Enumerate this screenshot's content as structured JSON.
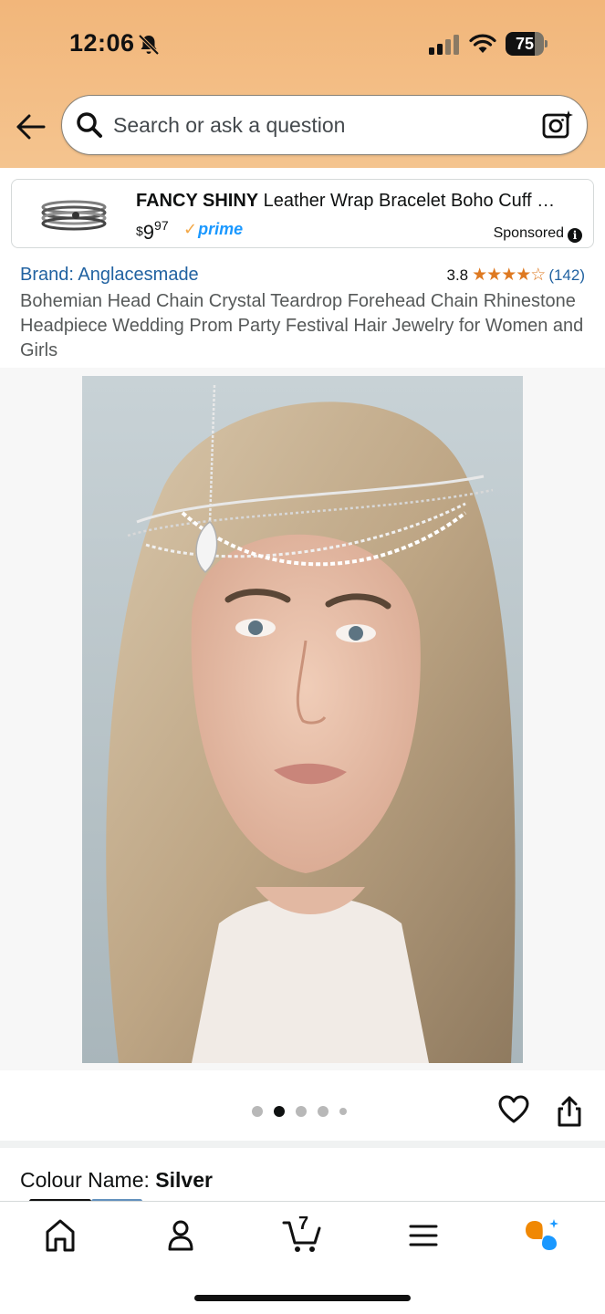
{
  "status_bar": {
    "time": "12:06",
    "battery": "75",
    "battery_level": 0.75
  },
  "header": {
    "search_placeholder": "Search or ask a question"
  },
  "sponsored": {
    "title_bold": "FANCY SHINY",
    "title_rest": " Leather Wrap Bracelet Boho Cuff …",
    "price_currency": "$",
    "price_dollars": "9",
    "price_cents": "97",
    "prime_label": "prime",
    "sponsored_label": "Sponsored",
    "info_glyph": "i"
  },
  "product": {
    "brand": "Brand: Anglacesmade",
    "rating_value": "3.8",
    "rating_stars": 3.8,
    "rating_stars_display": "★★★★☆",
    "rating_count": "(142)",
    "title": "Bohemian Head Chain Crystal Teardrop Forehead Chain Rhinestone Headpiece Wedding Prom Party Festival Hair Jewelry for Women and Girls"
  },
  "carousel": {
    "total_dots": 5,
    "active_index": 1
  },
  "variant": {
    "label": "Colour Name: ",
    "value": "Silver"
  },
  "bottom_nav": {
    "items": [
      "home-icon",
      "account-icon",
      "cart-icon",
      "menu-icon",
      "rufus-icon"
    ],
    "cart_count": "7"
  },
  "colors": {
    "header_bg": "#f2b67a",
    "link": "#2162a1",
    "star": "#de7921",
    "prime": "#1a98ff",
    "rufus_orange": "#f08804",
    "rufus_blue": "#1a98ff"
  }
}
